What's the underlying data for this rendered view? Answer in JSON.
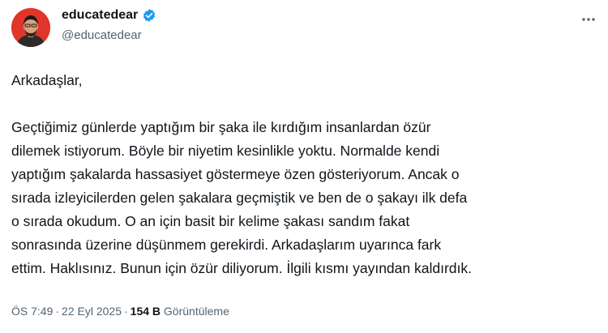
{
  "author": {
    "display_name": "educatedear",
    "handle": "@educatedear",
    "verified": true,
    "avatar": "avatar-person-on-red",
    "avatar_color": "#e0352b",
    "badge_color": "#1d9bf0"
  },
  "more_icon": "more-horizontal-icon",
  "body": {
    "greeting": "Arkadaşlar,",
    "lines": [
      "Geçtiğimiz günlerde yaptığım bir şaka ile kırdığım insanlardan özür",
      "dilemek istiyorum. Böyle bir niyetim kesinlikle yoktu. Normalde kendi",
      "yaptığım şakalarda hassasiyet göstermeye özen gösteriyorum. Ancak o",
      "sırada izleyicilerden gelen şakalara geçmiştik ve ben de o şakayı ilk defa",
      "o sırada okudum. O an için basit bir kelime şakası sandım fakat",
      "sonrasında üzerine düşünmem gerekirdi. Arkadaşlarım uyarınca fark",
      "ettim. Haklısınız. Bunun için özür diliyorum. İlgili kısmı yayından kaldırdık."
    ]
  },
  "meta": {
    "time": "ÖS 7:49",
    "separator": "·",
    "date": "22 Eyl 2025",
    "views_count": "154 B",
    "views_label": "Görüntüleme"
  },
  "colors": {
    "text": "#0f1419",
    "secondary": "#536471"
  }
}
